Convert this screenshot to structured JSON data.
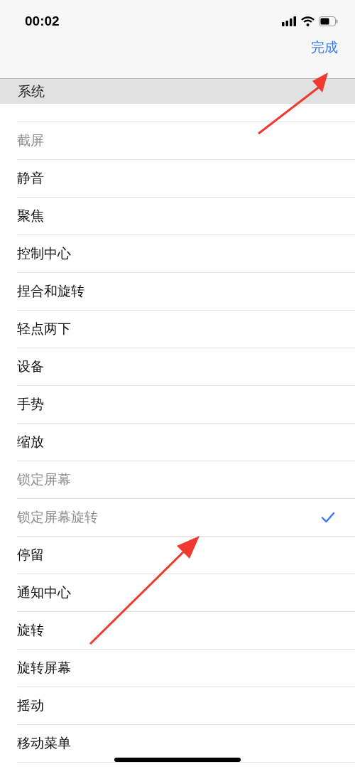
{
  "status_bar": {
    "time": "00:02"
  },
  "nav": {
    "done": "完成"
  },
  "section": {
    "title": "系统"
  },
  "items": [
    {
      "label": "截屏",
      "disabled": true,
      "checked": false
    },
    {
      "label": "静音",
      "disabled": false,
      "checked": false
    },
    {
      "label": "聚焦",
      "disabled": false,
      "checked": false
    },
    {
      "label": "控制中心",
      "disabled": false,
      "checked": false
    },
    {
      "label": "捏合和旋转",
      "disabled": false,
      "checked": false
    },
    {
      "label": "轻点两下",
      "disabled": false,
      "checked": false
    },
    {
      "label": "设备",
      "disabled": false,
      "checked": false
    },
    {
      "label": "手势",
      "disabled": false,
      "checked": false
    },
    {
      "label": "缩放",
      "disabled": false,
      "checked": false
    },
    {
      "label": "锁定屏幕",
      "disabled": true,
      "checked": false
    },
    {
      "label": "锁定屏幕旋转",
      "disabled": true,
      "checked": true
    },
    {
      "label": "停留",
      "disabled": false,
      "checked": false
    },
    {
      "label": "通知中心",
      "disabled": false,
      "checked": false
    },
    {
      "label": "旋转",
      "disabled": false,
      "checked": false
    },
    {
      "label": "旋转屏幕",
      "disabled": false,
      "checked": false
    },
    {
      "label": "摇动",
      "disabled": false,
      "checked": false
    },
    {
      "label": "移动菜单",
      "disabled": false,
      "checked": false
    }
  ]
}
